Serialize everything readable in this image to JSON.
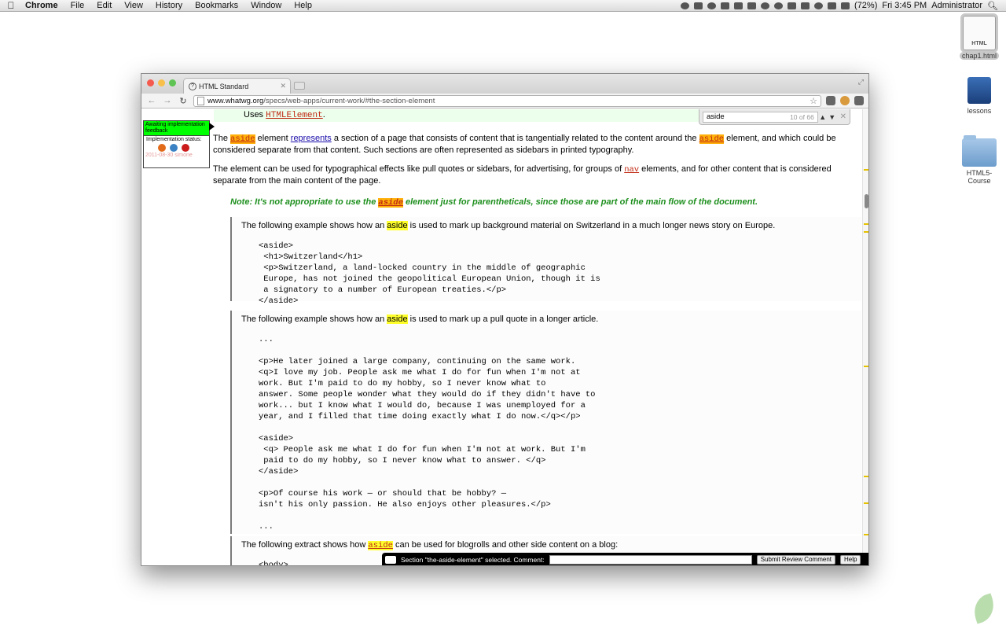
{
  "menubar": {
    "app_name": "Chrome",
    "items": [
      "File",
      "Edit",
      "View",
      "History",
      "Bookmarks",
      "Window",
      "Help"
    ],
    "battery": "(72%)",
    "clock": "Fri 3:45 PM",
    "user": "Administrator"
  },
  "desktop": {
    "icons": [
      {
        "label": "chap1.html",
        "badge": "HTML"
      },
      {
        "label": "lessons"
      },
      {
        "label": "HTML5-Course"
      }
    ]
  },
  "browser": {
    "tab_title": "HTML Standard",
    "url_host": "www.whatwg.org",
    "url_path": "/specs/web-apps/current-work/#the-section-element",
    "find": {
      "query": "aside",
      "count": "10 of 66"
    }
  },
  "page": {
    "uses_prefix": "Uses ",
    "uses_interface": "HTMLElement",
    "uses_suffix": ".",
    "status": {
      "awaiting": "Awaiting implementation feedback",
      "impl_label": "Implementation status:",
      "date": "2011-08-30 simone"
    },
    "para1": {
      "t1": "The ",
      "el": "aside",
      "t2": " element ",
      "link": "represents",
      "t3": " a section of a page that consists of content that is tangentially related to the content around the ",
      "el2": "aside",
      "t4": " element, and which could be considered separate from that content. Such sections are often represented as sidebars in printed typography."
    },
    "para2": {
      "t1": "The element can be used for typographical effects like pull quotes or sidebars, for advertising, for groups of ",
      "el": "nav",
      "t2": " elements, and for other content that is considered separate from the main content of the page."
    },
    "note": {
      "t1": "Note: It's not appropriate to use the ",
      "el": "aside",
      "t2": " element just for parentheticals, since those are part of the main flow of the document."
    },
    "example1": {
      "t1": "The following example shows how an ",
      "el": "aside",
      "t2": " is used to mark up background material on Switzerland in a much longer news story on Europe.",
      "code": "<aside>\n <h1>Switzerland</h1>\n <p>Switzerland, a land-locked country in the middle of geographic\n Europe, has not joined the geopolitical European Union, though it is\n a signatory to a number of European treaties.</p>\n</aside>"
    },
    "example2": {
      "t1": "The following example shows how an ",
      "el": "aside",
      "t2": " is used to mark up a pull quote in a longer article.",
      "code": "...\n\n<p>He later joined a large company, continuing on the same work.\n<q>I love my job. People ask me what I do for fun when I'm not at\nwork. But I'm paid to do my hobby, so I never know what to\nanswer. Some people wonder what they would do if they didn't have to\nwork... but I know what I would do, because I was unemployed for a\nyear, and I filled that time doing exactly what I do now.</q></p>\n\n<aside>\n <q> People ask me what I do for fun when I'm not at work. But I'm\n paid to do my hobby, so I never know what to answer. </q>\n</aside>\n\n<p>Of course his work — or should that be hobby? —\nisn't his only passion. He also enjoys other pleasures.</p>\n\n..."
    },
    "example3": {
      "t1": "The following extract shows how ",
      "el": "aside",
      "t2": " can be used for blogrolls and other side content on a blog:",
      "code": "<body>"
    },
    "review": {
      "label": "Section \"the-aside-element\" selected. Comment:",
      "submit": "Submit Review Comment",
      "help": "Help"
    }
  }
}
